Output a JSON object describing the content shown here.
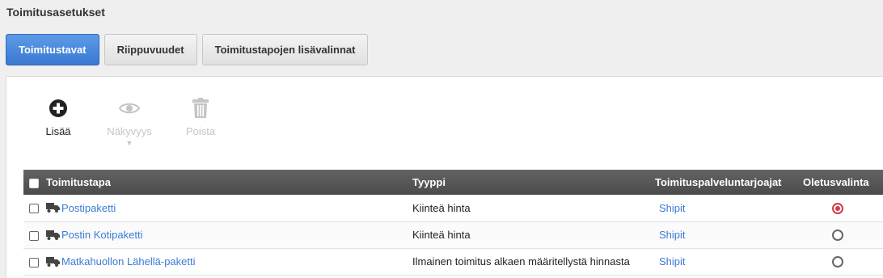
{
  "page": {
    "title": "Toimitusasetukset"
  },
  "tabs": [
    {
      "label": "Toimitustavat",
      "active": true
    },
    {
      "label": "Riippuvuudet",
      "active": false
    },
    {
      "label": "Toimitustapojen lisävalinnat",
      "active": false
    }
  ],
  "toolbar": {
    "add_label": "Lisää",
    "visibility_label": "Näkyvyys",
    "delete_label": "Poista"
  },
  "table": {
    "headers": {
      "name": "Toimitustapa",
      "type": "Tyyppi",
      "providers": "Toimituspalveluntarjoajat",
      "default": "Oletusvalinta"
    },
    "rows": [
      {
        "name": "Postipaketti",
        "type": "Kiinteä hinta",
        "provider": "Shipit",
        "default": true
      },
      {
        "name": "Postin Kotipaketti",
        "type": "Kiinteä hinta",
        "provider": "Shipit",
        "default": false
      },
      {
        "name": "Matkahuollon Lähellä-paketti",
        "type": "Ilmainen toimitus alkaen määritellystä hinnasta",
        "provider": "Shipit",
        "default": false
      }
    ]
  },
  "colors": {
    "accent": "#3a78d2",
    "link": "#3b7bd4",
    "radio_selected": "#d23b4a",
    "header_bg": "#555555"
  }
}
